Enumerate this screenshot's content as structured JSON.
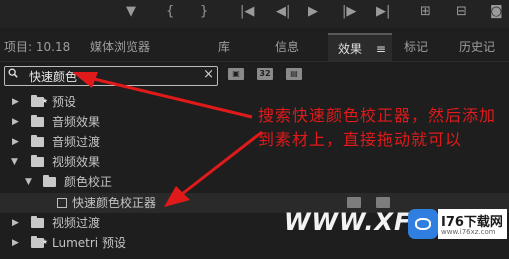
{
  "tabs": [
    {
      "label": "项目: 10.18"
    },
    {
      "label": "媒体浏览器"
    },
    {
      "label": "库"
    },
    {
      "label": "信息"
    },
    {
      "label": "效果",
      "active": true,
      "menu": "≡"
    },
    {
      "label": "标记"
    },
    {
      "label": "历史记"
    }
  ],
  "search": {
    "value": "快速颜色",
    "clear": "×"
  },
  "filter_buttons": [
    "32"
  ],
  "tree": [
    {
      "label": "预设"
    },
    {
      "label": "音频效果"
    },
    {
      "label": "音频过渡"
    },
    {
      "label": "视频效果"
    },
    {
      "label": "颜色校正"
    },
    {
      "label": "快速颜色校正器"
    },
    {
      "label": "视频过渡"
    },
    {
      "label": "Lumetri 预设"
    }
  ],
  "annotation": {
    "text": "搜索快速颜色校正器，然后添加到素材上，直接拖动就可以"
  },
  "watermark": {
    "text": "WWW.XFDO",
    "logo_title": "I76下载网",
    "logo_url": "www.i76xz.com"
  },
  "colors": {
    "annotation": "#e01a1a",
    "background": "#1e1e1e",
    "logo_blue": "#2f7ee0"
  }
}
